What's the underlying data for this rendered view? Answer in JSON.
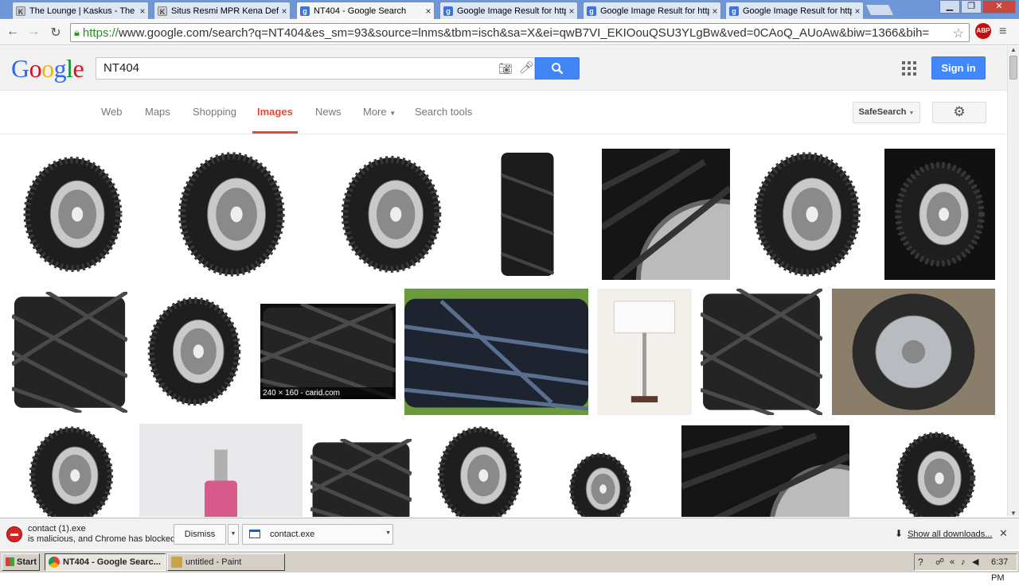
{
  "browser": {
    "tabs": [
      {
        "title": "The Lounge | Kaskus - The L",
        "icon": "kaskus-icon"
      },
      {
        "title": "Situs Resmi MPR Kena Defac",
        "icon": "kaskus-icon"
      },
      {
        "title": "NT404 - Google Search",
        "icon": "google-icon",
        "active": true
      },
      {
        "title": "Google Image Result for http",
        "icon": "google-icon"
      },
      {
        "title": "Google Image Result for http",
        "icon": "google-icon"
      },
      {
        "title": "Google Image Result for http",
        "icon": "google-icon"
      }
    ],
    "url_scheme": "https://",
    "url_rest": "www.google.com/search?q=NT404&es_sm=93&source=lnms&tbm=isch&sa=X&ei=qwB7VI_EKIOouQSU3YLgBw&ved=0CAoQ_AUoAw&biw=1366&bih=",
    "abp_label": "ABP"
  },
  "google": {
    "logo_letters": [
      "G",
      "o",
      "o",
      "g",
      "l",
      "e"
    ],
    "query": "NT404",
    "signin_label": "Sign in",
    "nav_tabs": [
      "Web",
      "Maps",
      "Shopping",
      "Images",
      "News",
      "More",
      "Search tools"
    ],
    "active_tab": "Images",
    "safesearch_label": "SafeSearch",
    "image_caption": "240 × 160 - carid.com"
  },
  "download_bar": {
    "warning_line1": "contact (1).exe",
    "warning_line2": "is malicious, and Chrome has blocked it.",
    "dismiss_label": "Dismiss",
    "file_name": "contact.exe",
    "show_all_label": "Show all downloads..."
  },
  "taskbar": {
    "start_label": "Start",
    "tasks": [
      "NT404 - Google Searc...",
      "untitled - Paint"
    ],
    "clock": "6:37 PM"
  },
  "colors": {
    "accent_red": "#dd4b39",
    "google_blue": "#4285f4",
    "tab_bar": "#6d97d8"
  }
}
